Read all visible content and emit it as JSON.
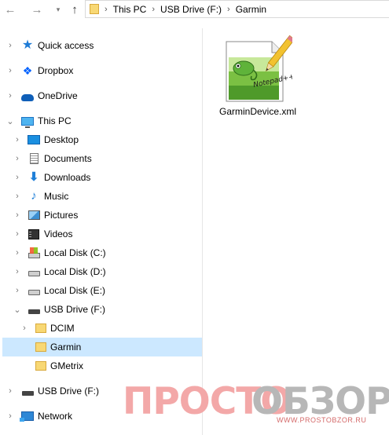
{
  "address_bar": {
    "back": "←",
    "forward": "→",
    "up": "↑",
    "separator": "›",
    "crumbs": [
      "This PC",
      "USB Drive (F:)",
      "Garmin"
    ]
  },
  "nav_pane": {
    "items": [
      {
        "label": "Quick access",
        "icon": "quick-access-star-icon",
        "chevron": "›"
      },
      {
        "label": "Dropbox",
        "icon": "dropbox-icon",
        "chevron": "›"
      },
      {
        "label": "OneDrive",
        "icon": "onedrive-cloud-icon",
        "chevron": "›"
      },
      {
        "label": "This PC",
        "icon": "this-pc-monitor-icon",
        "chevron": "⌄"
      },
      {
        "label": "Desktop",
        "icon": "desktop-icon",
        "chevron": "›"
      },
      {
        "label": "Documents",
        "icon": "documents-icon",
        "chevron": "›"
      },
      {
        "label": "Downloads",
        "icon": "downloads-arrow-icon",
        "chevron": "›"
      },
      {
        "label": "Music",
        "icon": "music-note-icon",
        "chevron": "›"
      },
      {
        "label": "Pictures",
        "icon": "pictures-icon",
        "chevron": "›"
      },
      {
        "label": "Videos",
        "icon": "videos-filmstrip-icon",
        "chevron": "›"
      },
      {
        "label": "Local Disk (C:)",
        "icon": "system-drive-icon",
        "chevron": "›"
      },
      {
        "label": "Local Disk (D:)",
        "icon": "hard-drive-icon",
        "chevron": "›"
      },
      {
        "label": "Local Disk (E:)",
        "icon": "hard-drive-icon",
        "chevron": "›"
      },
      {
        "label": "USB Drive (F:)",
        "icon": "usb-drive-icon",
        "chevron": "⌄"
      },
      {
        "label": "DCIM",
        "icon": "folder-icon",
        "chevron": "›"
      },
      {
        "label": "Garmin",
        "icon": "folder-icon",
        "chevron": ""
      },
      {
        "label": "GMetrix",
        "icon": "folder-icon",
        "chevron": ""
      },
      {
        "label": "USB Drive (F:)",
        "icon": "usb-drive-icon",
        "chevron": "›"
      },
      {
        "label": "Network",
        "icon": "network-icon",
        "chevron": "›"
      }
    ]
  },
  "content": {
    "files": [
      {
        "name": "GarminDevice.xml",
        "icon": "notepad-plus-plus-file-icon",
        "logo_text": "Notepad++"
      }
    ]
  },
  "watermark": {
    "part_a": "ПРОСТО",
    "part_b": "ОБЗОР",
    "url": "WWW.PROSTOBZOR.RU"
  },
  "colors": {
    "selection": "#cce8ff",
    "folder": "#f8d874",
    "accent_blue": "#1e7bd6",
    "watermark_red": "#f3a8a8"
  }
}
